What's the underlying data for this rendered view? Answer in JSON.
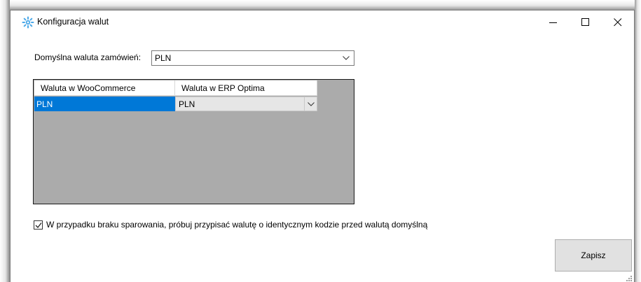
{
  "window": {
    "title": "Konfiguracja walut",
    "icon": "gear-sun-icon"
  },
  "default_currency": {
    "label": "Domyślna waluta zamówień:",
    "value": "PLN"
  },
  "grid": {
    "columns": [
      "Waluta w WooCommerce",
      "Waluta w ERP Optima"
    ],
    "rows": [
      {
        "woocommerce": "PLN",
        "erp": "PLN"
      }
    ],
    "selection_color": "#0078d7",
    "background_color": "#ababab"
  },
  "fallback_option": {
    "label": "W przypadku braku sparowania, próbuj przypisać walutę o identycznym kodzie przed walutą domyślną",
    "checked": true
  },
  "actions": {
    "save_label": "Zapisz"
  }
}
